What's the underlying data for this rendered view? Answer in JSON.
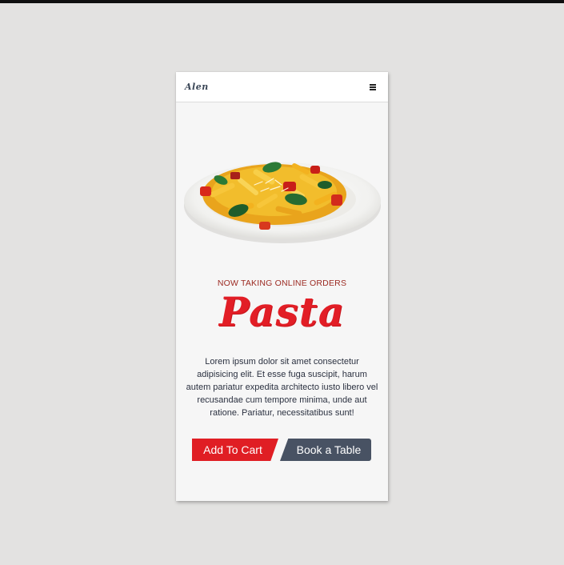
{
  "navbar": {
    "brand": "Alen",
    "menu_icon": "hamburger-menu-icon"
  },
  "hero": {
    "image": "pasta-plate-image",
    "tagline": "NOW TAKING ONLINE ORDERS",
    "title": "Pasta",
    "description": "Lorem ipsum dolor sit amet consectetur adipisicing elit. Et esse fuga suscipit, harum autem pariatur expedita architecto iusto libero vel recusandae cum tempore minima, unde aut ratione. Pariatur, necessitatibus sunt!"
  },
  "actions": {
    "add_to_cart": "Add To Cart",
    "book_table": "Book a Table"
  },
  "colors": {
    "background": "#e3e2e1",
    "card": "#f6f6f6",
    "accent_red": "#e01e24",
    "slate": "#485263",
    "tagline": "#9c2a22"
  }
}
